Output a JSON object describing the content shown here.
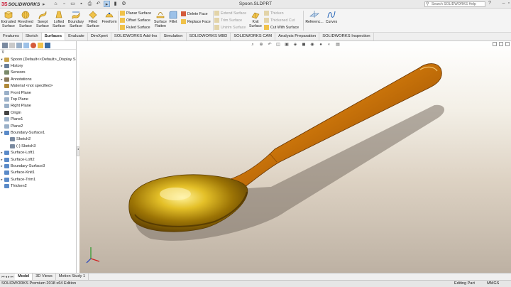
{
  "app": {
    "logo_ds": "3S",
    "logo_text": "SOLIDWORKS",
    "document_title": "Spoon.SLDPRT"
  },
  "search": {
    "placeholder": "Search SOLIDWORKS Help"
  },
  "ribbon": {
    "big_buttons": [
      {
        "label": "Extruded Surface"
      },
      {
        "label": "Revolved Surface"
      },
      {
        "label": "Swept Surface"
      },
      {
        "label": "Lofted Surface"
      },
      {
        "label": "Boundary Surface"
      },
      {
        "label": "Filled Surface"
      },
      {
        "label": "Freeform"
      }
    ],
    "planar_surface": "Planar Surface",
    "offset_surface": "Offset Surface",
    "ruled_surface": "Ruled Surface",
    "surface_flatten": "Surface Flatten",
    "fillet": "Fillet",
    "delete_face": "Delete Face",
    "replace_face": "Replace Face",
    "extend_surface": "Extend Surface",
    "trim_surface": "Trim Surface",
    "untrim_surface": "Untrim Surface",
    "knit_surface": "Knit Surface",
    "thicken": "Thicken",
    "thickened_cut": "Thickened Cut",
    "cut_with_surface": "Cut With Surface",
    "reference": "Referenc...",
    "curves": "Curves"
  },
  "tabs": [
    "Features",
    "Sketch",
    "Surfaces",
    "Evaluate",
    "DimXpert",
    "SOLIDWORKS Add-Ins",
    "Simulation",
    "SOLIDWORKS MBD",
    "SOLIDWORKS CAM",
    "Analysis Preparation",
    "SOLIDWORKS Inspection"
  ],
  "active_tab": "Surfaces",
  "tree": {
    "root": "Spoon  (Default<<Default>_Display S",
    "items": [
      {
        "label": "History",
        "arrow": "▸",
        "color": "#6b7f9a"
      },
      {
        "label": "Sensors",
        "arrow": "",
        "color": "#7a8a6a"
      },
      {
        "label": "Annotations",
        "arrow": "▸",
        "color": "#8a7a5a"
      },
      {
        "label": "Material <not specified>",
        "arrow": "",
        "color": "#b08a3a"
      },
      {
        "label": "Front Plane",
        "arrow": "",
        "color": "#9ab0c8"
      },
      {
        "label": "Top Plane",
        "arrow": "",
        "color": "#9ab0c8"
      },
      {
        "label": "Right Plane",
        "arrow": "",
        "color": "#9ab0c8"
      },
      {
        "label": "Origin",
        "arrow": "",
        "color": "#444444"
      },
      {
        "label": "Plane1",
        "arrow": "",
        "color": "#9ab0c8"
      },
      {
        "label": "Plane2",
        "arrow": "",
        "color": "#9ab0c8"
      },
      {
        "label": "Boundary-Surface1",
        "arrow": "▾",
        "color": "#5a8ac8"
      },
      {
        "label": "Sketch2",
        "arrow": "",
        "color": "#7a8aa0",
        "indent": 1
      },
      {
        "label": "(-) Sketch3",
        "arrow": "",
        "color": "#7a8aa0",
        "indent": 1
      },
      {
        "label": "Surface-Loft1",
        "arrow": "▸",
        "color": "#5a8ac8"
      },
      {
        "label": "Surface-Loft2",
        "arrow": "▸",
        "color": "#5a8ac8"
      },
      {
        "label": "Boundary-Surface3",
        "arrow": "▸",
        "color": "#5a8ac8"
      },
      {
        "label": "Surface-Knit1",
        "arrow": "",
        "color": "#5a8ac8"
      },
      {
        "label": "Surface-Trim1",
        "arrow": "▸",
        "color": "#5a8ac8"
      },
      {
        "label": "Thicken2",
        "arrow": "",
        "color": "#5a8ac8"
      }
    ]
  },
  "bottom_tabs": [
    "Model",
    "3D Views",
    "Motion Study 1"
  ],
  "active_bottom_tab": "Model",
  "status": {
    "left": "SOLIDWORKS Premium 2018 x64 Edition",
    "mode": "Editing Part",
    "units": "MMGS"
  },
  "colors": {
    "accent_red": "#c8102e",
    "spoon_gold": "#c8860f",
    "tab_active": "#ffffff"
  }
}
